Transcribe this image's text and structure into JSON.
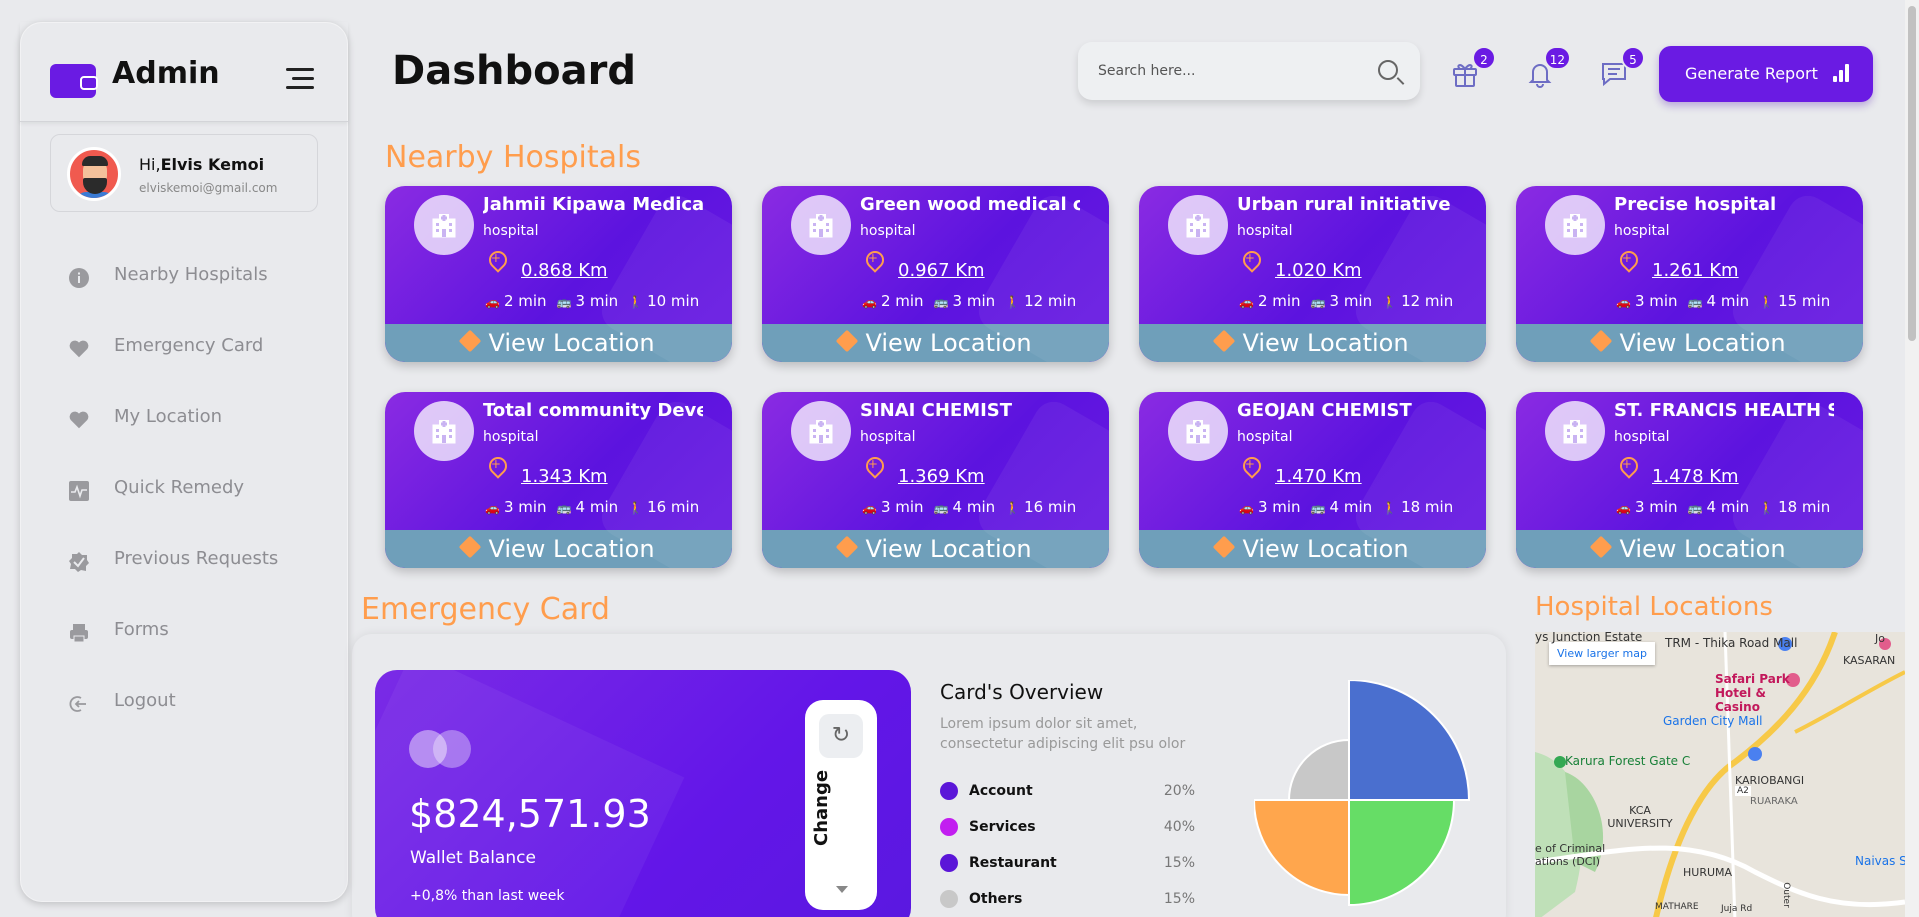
{
  "brand": {
    "title": "Admin"
  },
  "user": {
    "greeting": "Hi,",
    "name": "Elvis Kemoi",
    "email": "elviskemoi@gmail.com"
  },
  "sidebar": {
    "items": [
      {
        "label": "Nearby Hospitals",
        "icon": "info-icon"
      },
      {
        "label": "Emergency Card",
        "icon": "heart-icon"
      },
      {
        "label": "My Location",
        "icon": "heart-icon"
      },
      {
        "label": "Quick Remedy",
        "icon": "pulse-icon"
      },
      {
        "label": "Previous Requests",
        "icon": "badge-check-icon"
      },
      {
        "label": "Forms",
        "icon": "printer-icon"
      },
      {
        "label": "Logout",
        "icon": "logout-icon"
      }
    ]
  },
  "header": {
    "title": "Dashboard",
    "search_placeholder": "Search here...",
    "gift_count": "2",
    "bell_count": "12",
    "message_count": "5",
    "generate_label": "Generate Report"
  },
  "sections": {
    "hospitals": "Nearby Hospitals",
    "emergency": "Emergency Card",
    "locations": "Hospital Locations"
  },
  "hospitals": [
    {
      "name": "Jahmii Kipawa Medical Centre",
      "type": "hospital",
      "distance": "0.868 Km",
      "car": "2 min",
      "bus": "3 min",
      "walk": "10 min",
      "action": "View Location"
    },
    {
      "name": "Green wood medical clinic",
      "type": "hospital",
      "distance": "0.967 Km",
      "car": "2 min",
      "bus": "3 min",
      "walk": "12 min",
      "action": "View Location"
    },
    {
      "name": "Urban rural initiative overseas",
      "type": "hospital",
      "distance": "1.020 Km",
      "car": "2 min",
      "bus": "3 min",
      "walk": "12 min",
      "action": "View Location"
    },
    {
      "name": "Precise hospital",
      "type": "hospital",
      "distance": "1.261 Km",
      "car": "3 min",
      "bus": "4 min",
      "walk": "15 min",
      "action": "View Location"
    },
    {
      "name": "Total community Development",
      "type": "hospital",
      "distance": "1.343 Km",
      "car": "3 min",
      "bus": "4 min",
      "walk": "16 min",
      "action": "View Location"
    },
    {
      "name": "SINAI CHEMIST",
      "type": "hospital",
      "distance": "1.369 Km",
      "car": "3 min",
      "bus": "4 min",
      "walk": "16 min",
      "action": "View Location"
    },
    {
      "name": "GEOJAN CHEMIST",
      "type": "hospital",
      "distance": "1.470 Km",
      "car": "3 min",
      "bus": "4 min",
      "walk": "18 min",
      "action": "View Location"
    },
    {
      "name": "ST. FRANCIS HEALTH SERVICES",
      "type": "hospital",
      "distance": "1.478 Km",
      "car": "3 min",
      "bus": "4 min",
      "walk": "18 min",
      "action": "View Location"
    }
  ],
  "wallet": {
    "amount": "$824,571.93",
    "label": "Wallet Balance",
    "delta": "+0,8% than last week",
    "change_label": "Change"
  },
  "overview": {
    "title": "Card's Overview",
    "description": "Lorem ipsum dolor sit amet, consectetur adipiscing elit psu olor",
    "items": [
      {
        "name": "Account",
        "pct": "20%",
        "color": "#5b16d8"
      },
      {
        "name": "Services",
        "pct": "40%",
        "color": "#c21ef0"
      },
      {
        "name": "Restaurant",
        "pct": "15%",
        "color": "#5b16d8"
      },
      {
        "name": "Others",
        "pct": "15%",
        "color": "#c8c8c8"
      }
    ]
  },
  "pie_colors": {
    "blue": "#4a6fcf",
    "green": "#66dd66",
    "orange": "#ffa64d",
    "gray": "#c8c8c8"
  },
  "map": {
    "larger_link": "View larger map",
    "labels": [
      "ys Junction Estate",
      "TRM - Thika Road Mall",
      "Safari Park Hotel & Casino",
      "Garden City Mall",
      "Karura Forest Gate C",
      "KARIOBANGI",
      "RUARAKA",
      "KCA UNIVERSITY",
      "e of Criminal ations (DCI)",
      "HURUMA",
      "Naivas S",
      "KASARAN",
      "Jo",
      "A2",
      "MATHARE",
      "Juja Rd",
      "Outer"
    ]
  },
  "colors": {
    "accent": "#6a1be3",
    "orange": "#ff9d4d",
    "view_bar": "#6f9fba"
  }
}
